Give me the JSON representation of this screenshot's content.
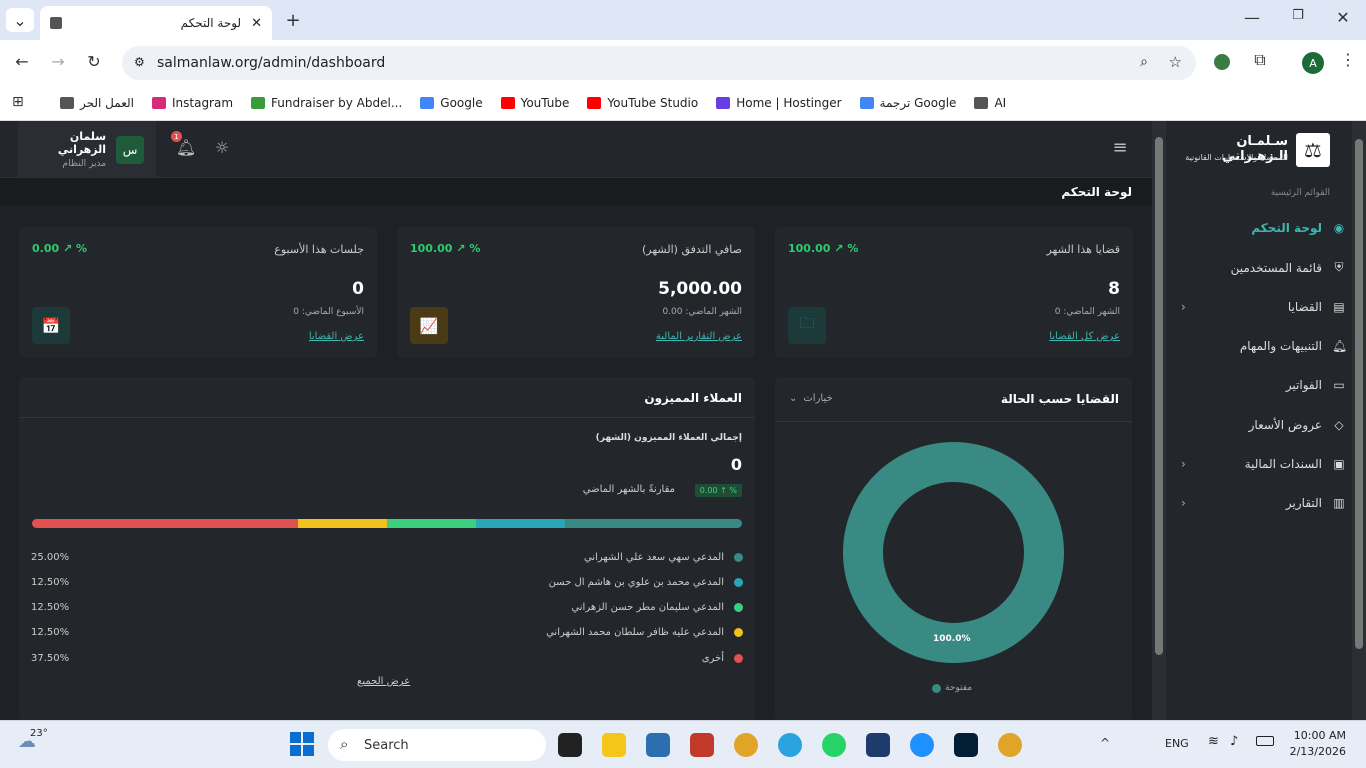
{
  "browser": {
    "tab_title": "لوحة التحكم",
    "url": "salmanlaw.org/admin/dashboard",
    "profile_initial": "A",
    "bookmarks": [
      {
        "label": "العمل الحر",
        "color": "#555"
      },
      {
        "label": "Instagram",
        "color": "#d62976"
      },
      {
        "label": "Fundraiser by Abdel...",
        "color": "#3a9b3a"
      },
      {
        "label": "Google",
        "color": "#4285f4"
      },
      {
        "label": "YouTube",
        "color": "#ff0000"
      },
      {
        "label": "YouTube Studio",
        "color": "#ff0000"
      },
      {
        "label": "Home | Hostinger",
        "color": "#673de6"
      },
      {
        "label": "ترجمة Google",
        "color": "#4285f4"
      },
      {
        "label": "AI",
        "color": "#555"
      }
    ]
  },
  "header": {
    "user_name": "سلمان الزهراني",
    "user_role": "مدير النظام",
    "avatar_letter": "س",
    "notification_count": "1"
  },
  "page_title": "لوحة التحكم",
  "kpis": [
    {
      "title": "قضايا هذا الشهر",
      "value": "8",
      "change": "100.00 ↗ %",
      "sub": "الشهر الماضي: 0",
      "link": "عرض كل القضايا",
      "icon_color": "#2f7b79",
      "icon": "folder-icon",
      "icon_glyph": "🗀"
    },
    {
      "title": "صافي التدفق (الشهر)",
      "value": "5,000.00",
      "change": "100.00 ↗ %",
      "sub": "الشهر الماضي: 0.00",
      "link": "عرض التقارير المالية",
      "icon_color": "#e0a528",
      "icon": "chart-icon",
      "icon_glyph": "📈"
    },
    {
      "title": "جلسات هذا الأسبوع",
      "value": "0",
      "change": "0.00 ↗ %",
      "sub": "الأسبوع الماضي: 0",
      "link": "عرض القضايا",
      "icon_color": "#2f7b79",
      "icon": "calendar-icon",
      "icon_glyph": "📅"
    }
  ],
  "status_card": {
    "title": "القضايا حسب الحالة",
    "options_label": "خيارات",
    "center_pct": "100.0%",
    "legend": "مفتوحة",
    "ring_color": "#3a8a84"
  },
  "clients_card": {
    "title": "العملاء المميزون",
    "total_label": "إجمالي العملاء المميزون (الشهر)",
    "total_value": "0",
    "badge": "0.00 ↑ %",
    "compare_label": "مقارنةً بالشهر الماضي",
    "view_all": "عرض الجميع",
    "segments": [
      {
        "name": "المدعي سهي سعد علي الشهراني",
        "pct": "25.00%",
        "share": 25,
        "color": "#3a8a84"
      },
      {
        "name": "المدعي محمد بن علوي بن هاشم ال حسن",
        "pct": "12.50%",
        "share": 12.5,
        "color": "#2ba6b8"
      },
      {
        "name": "المدعي سليمان مطر حسن الزهراني",
        "pct": "12.50%",
        "share": 12.5,
        "color": "#3ccf7e"
      },
      {
        "name": "المدعي عليه ظافر سلطان محمد الشهراني",
        "pct": "12.50%",
        "share": 12.5,
        "color": "#f1c21b"
      },
      {
        "name": "أخرى",
        "pct": "37.50%",
        "share": 37.5,
        "color": "#e05252"
      }
    ]
  },
  "sidebar": {
    "brand_name": "سـلمـان الـزهـراني",
    "brand_sub": "للمحاماة والاستشارات القانونية",
    "section": "القوائم الرئيسية",
    "items": [
      {
        "label": "لوحة التحكم",
        "icon": "dashboard-icon",
        "glyph": "◉",
        "active": true,
        "chev": false
      },
      {
        "label": "قائمة المستخدمين",
        "icon": "users-icon",
        "glyph": "⛨",
        "active": false,
        "chev": false
      },
      {
        "label": "القضايا",
        "icon": "cases-icon",
        "glyph": "▤",
        "active": false,
        "chev": true
      },
      {
        "label": "التنبيهات والمهام",
        "icon": "bell-icon",
        "glyph": "🔔︎",
        "active": false,
        "chev": false
      },
      {
        "label": "الفواتير",
        "icon": "invoice-icon",
        "glyph": "▭",
        "active": false,
        "chev": false
      },
      {
        "label": "عروض الأسعار",
        "icon": "tag-icon",
        "glyph": "◇",
        "active": false,
        "chev": false
      },
      {
        "label": "السندات المالية",
        "icon": "wallet-icon",
        "glyph": "▣",
        "active": false,
        "chev": true
      },
      {
        "label": "التقارير",
        "icon": "reports-icon",
        "glyph": "▥",
        "active": false,
        "chev": true
      }
    ]
  },
  "taskbar": {
    "weather": "23°",
    "search": "Search",
    "lang": "ENG",
    "time": "10:00 AM",
    "date": "2/13/2026"
  }
}
